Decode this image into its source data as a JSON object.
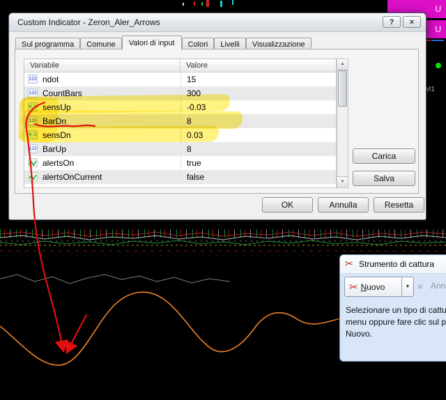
{
  "dialog": {
    "title": "Custom Indicator - Zeron_Aler_Arrows",
    "tabs": [
      {
        "label": "Sul programma"
      },
      {
        "label": "Comune"
      },
      {
        "label": "Valori di input"
      },
      {
        "label": "Colori"
      },
      {
        "label": "Livelli"
      },
      {
        "label": "Visualizzazione"
      }
    ],
    "table": {
      "headers": [
        "Variabile",
        "Valore"
      ],
      "rows": [
        {
          "type": "integer",
          "name": "ndot",
          "value": "15"
        },
        {
          "type": "integer",
          "name": "CountBars",
          "value": "300"
        },
        {
          "type": "double",
          "name": "sensUp",
          "value": "-0.03"
        },
        {
          "type": "integer",
          "name": "BarDn",
          "value": "8"
        },
        {
          "type": "double",
          "name": "sensDn",
          "value": "0.03"
        },
        {
          "type": "integer",
          "name": "BarUp",
          "value": "8"
        },
        {
          "type": "bool",
          "name": "alertsOn",
          "value": "true"
        },
        {
          "type": "bool",
          "name": "alertsOnCurrent",
          "value": "false"
        }
      ]
    },
    "side_buttons": {
      "load": "Carica",
      "save": "Salva"
    },
    "footer_buttons": {
      "ok": "OK",
      "cancel": "Annulla",
      "reset": "Resetta"
    }
  },
  "snipping_tool": {
    "title": "Strumento di cattura",
    "new_label": "Nuovo",
    "cancel_label": "Annulla",
    "description_lines": [
      "Selezionare un tipo di cattura dal",
      "menu oppure fare clic sul pulsante",
      "Nuovo."
    ]
  },
  "background": {
    "timeframe_label": "M1",
    "side_panel_letter_1": "U",
    "side_panel_letter_2": "U"
  },
  "icons": {
    "help": "?",
    "close": "×",
    "scroll_up": "▲",
    "scroll_down": "▼",
    "dropdown": "▼",
    "scissors": "✂",
    "integer_badge": "123",
    "double_badge": "0.5"
  },
  "colors": {
    "highlight": "#ffe500",
    "annotation_red": "#e01010",
    "indicator_orange": "#ef8428",
    "panel_magenta": "#dd10c8"
  }
}
